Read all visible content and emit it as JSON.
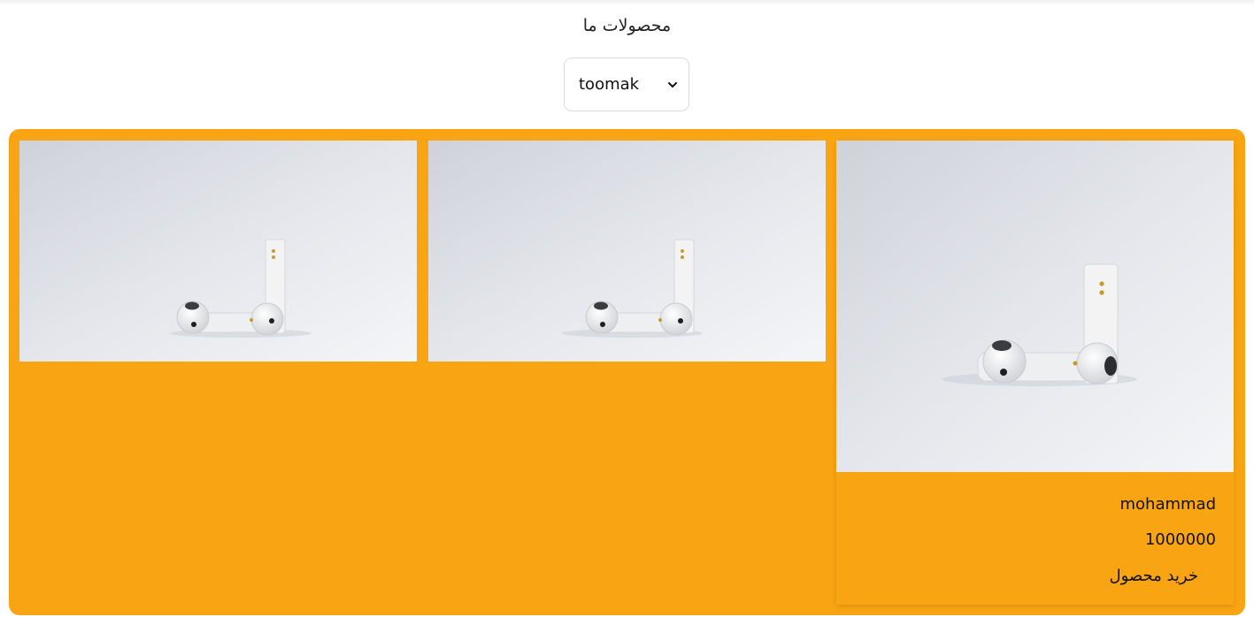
{
  "header": {
    "title": "محصولات ما"
  },
  "filter": {
    "selected": "toomak"
  },
  "products": [
    {
      "name": "mohammad",
      "price": "1000000",
      "buy_label": "خرید محصول",
      "image_icon": "earbuds-photo"
    },
    {
      "image_icon": "earbuds-photo"
    },
    {
      "image_icon": "earbuds-photo"
    }
  ],
  "colors": {
    "panel": "#f9a412",
    "background": "#ffffff"
  }
}
